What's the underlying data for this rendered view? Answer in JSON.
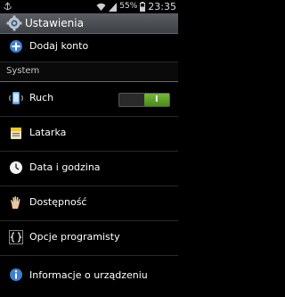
{
  "status_bar": {
    "battery": "55%",
    "time": "23:35"
  },
  "action_bar": {
    "title": "Ustawienia",
    "icon": "settings-gear-icon"
  },
  "items": [
    {
      "label": "Dodaj konto",
      "icon": "add-account-icon"
    },
    {
      "label": "Ruch",
      "icon": "motion-phone-icon",
      "toggle": {
        "state": "on",
        "knob_label": "I"
      }
    },
    {
      "label": "Latarka",
      "icon": "flashlight-icon"
    },
    {
      "label": "Data i godzina",
      "icon": "clock-icon"
    },
    {
      "label": "Dostępność",
      "icon": "hand-icon"
    },
    {
      "label": "Opcje programisty",
      "icon": "developer-braces-icon"
    },
    {
      "label": "Informacje o urządzeniu",
      "icon": "info-icon"
    }
  ],
  "sections": {
    "system": "System"
  },
  "colors": {
    "accent": "#1d7fb3",
    "toggle_on": "#5aa32a"
  }
}
